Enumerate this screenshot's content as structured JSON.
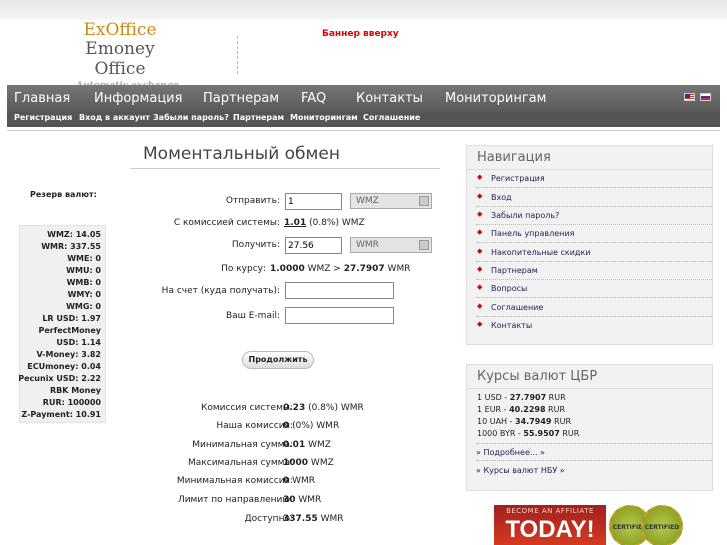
{
  "logo": {
    "line1": "ExOffice",
    "line2": "Emoney Office",
    "line3": "Automatic exchange"
  },
  "banner": "Баннер вверху",
  "menu": {
    "main": [
      "Главная",
      "Информация",
      "Партнерам",
      "FAQ",
      "Контакты",
      "Мониторингам"
    ],
    "sub": [
      "Регистрация",
      "Вход в аккаунт",
      "Забыли пароль?",
      "Партнерам",
      "Мониторингам",
      "Соглашение"
    ]
  },
  "page_title": "Моментальный обмен",
  "reserve": {
    "title": "Резерв валют:",
    "items": [
      "WMZ: 14.05",
      "WMR: 337.55",
      "WME: 0",
      "WMU: 0",
      "WMB: 0",
      "WMY: 0",
      "WMG: 0",
      "LR USD: 1.97",
      "PerfectMoney",
      "USD: 1.14",
      "V-Money: 3.82",
      "ECUmoney: 0.04",
      "Pecunix USD: 2.22",
      "RBK Money",
      "RUR: 100000",
      "Z-Payment: 10.91"
    ]
  },
  "form": {
    "send_label": "Отправить:",
    "send_value": "1",
    "send_currency": "WMZ",
    "commission_label": "С комиссией системы:",
    "commission_amount": "1.01",
    "commission_rest": " (0.8%) WMZ",
    "receive_label": "Получить:",
    "receive_value": "27.56",
    "receive_currency": "WMR",
    "rate_label": "По курсу:",
    "rate_left": "1.0000",
    "rate_mid": " WMZ > ",
    "rate_right": "27.7907",
    "rate_unit": " WMR",
    "account_label": "На счет (куда получать):",
    "email_label": "Ваш E-mail:",
    "continue": "Продолжить"
  },
  "stats": [
    {
      "label": "Комиссия системы:",
      "bold": "0.23",
      "rest": " (0.8%) WMR"
    },
    {
      "label": "Наша комиссия:",
      "bold": "0",
      "rest": " (0%) WMR"
    },
    {
      "label": "Минимальная сумма:",
      "bold": "0.01",
      "rest": " WMZ"
    },
    {
      "label": "Максимальная сумма:",
      "bold": "1000",
      "rest": " WMZ"
    },
    {
      "label": "Минимальная комиссия:",
      "bold": "0",
      "rest": " WMR"
    },
    {
      "label": "Лимит по направлению:",
      "bold": "30",
      "rest": " WMR"
    },
    {
      "label": "Доступно:",
      "bold": "337.55",
      "rest": " WMR"
    }
  ],
  "navigation": {
    "title": "Навигация",
    "items": [
      "Регистрация",
      "Вход",
      "Забыли пароль?",
      "Панель управления",
      "Накопительные скидки",
      "Партнерам",
      "Вопросы",
      "Соглашение",
      "Контакты"
    ]
  },
  "rates": {
    "title": "Курсы валют ЦБР",
    "items": [
      {
        "left": "1 USD - ",
        "bold": "27.7907",
        "right": " RUR"
      },
      {
        "left": "1 EUR - ",
        "bold": "40.2298",
        "right": " RUR"
      },
      {
        "left": "10 UAH - ",
        "bold": "34.7949",
        "right": " RUR"
      },
      {
        "left": "1000 BYR - ",
        "bold": "55.9507",
        "right": " RUR"
      }
    ],
    "more": "» Подробнее... »",
    "nbu": "» Курсы валют НБУ »"
  },
  "affiliate": {
    "line1": "BECOME AN AFFILIATE",
    "line2": "TODAY!"
  },
  "badges": [
    "CERTIFIED",
    "CERTIFIED"
  ]
}
